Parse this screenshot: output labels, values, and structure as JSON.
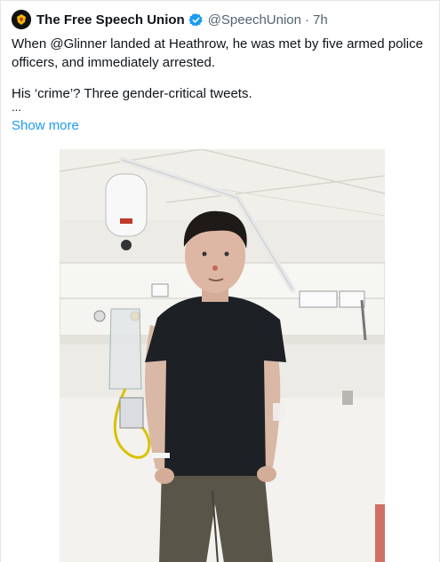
{
  "tweet": {
    "display_name": "The Free Speech Union",
    "handle": "@SpeechUnion",
    "separator": "·",
    "time": "7h",
    "verified_color": "#1d9bf0",
    "text_line_1": "When @Glinner landed at Heathrow, he was met by five armed police officers, and immediately arrested.",
    "text_line_2": "His ‘crime’? Three gender-critical tweets.",
    "ellipsis": "...",
    "show_more": "Show more",
    "link_color": "#1d9bf0"
  },
  "icons": {
    "avatar": "free-speech-union-logo",
    "verified": "verified-badge-icon"
  }
}
